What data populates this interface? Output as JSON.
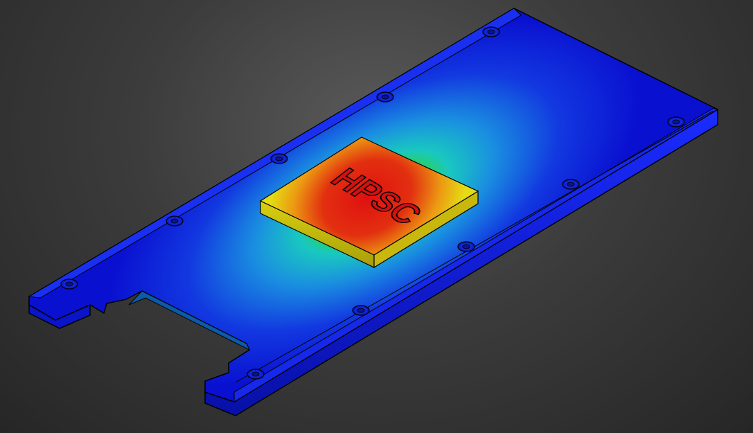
{
  "scene": {
    "chip_label": "HPSC",
    "colors": {
      "background_center": "#5a5a5a",
      "background_edge": "#262626",
      "cold": "#0a12d8",
      "cool": "#1a6be0",
      "mid": "#19c8c0",
      "warm": "#2fd23a",
      "hot_edge": "#e8e012",
      "hot": "#e01010",
      "outline": "#000000"
    }
  }
}
